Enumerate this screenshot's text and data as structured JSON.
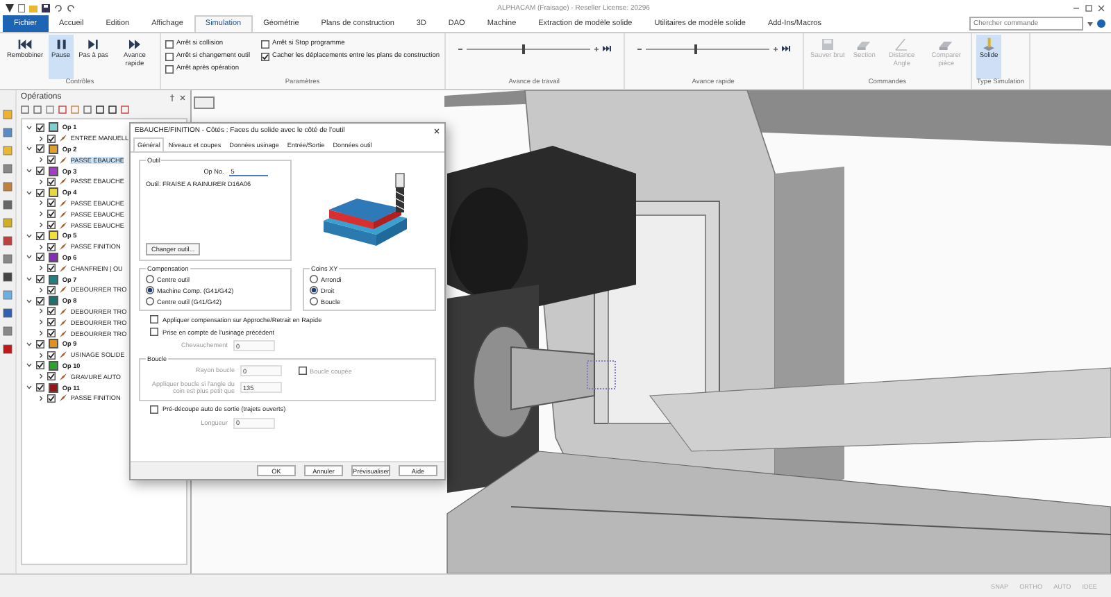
{
  "window": {
    "title": "ALPHACAM (Fraisage) - Reseller License: 20296"
  },
  "menu_tabs": [
    {
      "label": "Fichier",
      "kind": "file",
      "selected": false
    },
    {
      "label": "Accueil",
      "kind": "tab",
      "selected": false
    },
    {
      "label": "Edition",
      "kind": "tab",
      "selected": false
    },
    {
      "label": "Affichage",
      "kind": "tab",
      "selected": false
    },
    {
      "label": "Simulation",
      "kind": "tab",
      "selected": true
    },
    {
      "label": "Géométrie",
      "kind": "tab",
      "selected": false
    },
    {
      "label": "Plans de construction",
      "kind": "tab",
      "selected": false
    },
    {
      "label": "3D",
      "kind": "tab",
      "selected": false
    },
    {
      "label": "DAO",
      "kind": "tab",
      "selected": false
    },
    {
      "label": "Machine",
      "kind": "tab",
      "selected": false
    },
    {
      "label": "Extraction de modèle solide",
      "kind": "tab",
      "selected": false
    },
    {
      "label": "Utilitaires de modèle solide",
      "kind": "tab",
      "selected": false
    },
    {
      "label": "Add-Ins/Macros",
      "kind": "tab",
      "selected": false
    }
  ],
  "search": {
    "placeholder": "Chercher commande"
  },
  "ribbon": [
    {
      "title": "Contrôles",
      "kind": "buttons",
      "items": [
        {
          "label": "Rembobiner",
          "selected": false,
          "disabled": false
        },
        {
          "label": "Pause",
          "selected": true,
          "disabled": false
        },
        {
          "label": "Pas à pas",
          "selected": false,
          "disabled": false
        },
        {
          "label": "Avance rapide",
          "selected": false,
          "disabled": false
        }
      ]
    },
    {
      "title": "Paramètres",
      "kind": "checks",
      "items": [
        {
          "label": "Arrêt si collision",
          "checked": false
        },
        {
          "label": "Arrêt si changement outil",
          "checked": false
        },
        {
          "label": "Arrêt après opération",
          "checked": false
        },
        {
          "label": "Arrêt si Stop programme",
          "checked": false
        },
        {
          "label": "Cacher les déplacements entre les plans de construction",
          "checked": true
        }
      ]
    },
    {
      "title": "Avance de travail",
      "kind": "slider",
      "level": 0.45
    },
    {
      "title": "Avance rapide",
      "kind": "slider",
      "level": 0.4
    },
    {
      "title": "Commandes",
      "kind": "buttons",
      "items": [
        {
          "label": "Sauver brut",
          "selected": false,
          "disabled": true
        },
        {
          "label": "Section",
          "selected": false,
          "disabled": true
        },
        {
          "label": "Distance Angle",
          "selected": false,
          "disabled": true
        },
        {
          "label": "Comparer pièce",
          "selected": false,
          "disabled": true
        }
      ]
    },
    {
      "title": "Type Simulation",
      "kind": "buttons",
      "items": [
        {
          "label": "Solide",
          "selected": true,
          "disabled": false
        }
      ]
    }
  ],
  "operations": {
    "title": "Opérations",
    "items": [
      {
        "label": "Op 1",
        "color": "#7fcfcf",
        "checked": true,
        "expanded": true,
        "children": [
          {
            "label": "ENTREE MANUELL",
            "checked": true,
            "selected": false
          }
        ]
      },
      {
        "label": "Op 2",
        "color": "#e0a030",
        "checked": true,
        "expanded": true,
        "children": [
          {
            "label": "PASSE EBAUCHE",
            "checked": true,
            "selected": true
          }
        ]
      },
      {
        "label": "Op 3",
        "color": "#a040c0",
        "checked": true,
        "expanded": true,
        "children": [
          {
            "label": "PASSE EBAUCHE",
            "checked": true,
            "selected": false
          }
        ]
      },
      {
        "label": "Op 4",
        "color": "#e8d840",
        "checked": true,
        "expanded": true,
        "children": [
          {
            "label": "PASSE EBAUCHE",
            "checked": true,
            "selected": false
          },
          {
            "label": "PASSE EBAUCHE",
            "checked": true,
            "selected": false
          },
          {
            "label": "PASSE EBAUCHE",
            "checked": true,
            "selected": false
          }
        ]
      },
      {
        "label": "Op 5",
        "color": "#f0e040",
        "checked": true,
        "expanded": true,
        "children": [
          {
            "label": "PASSE FINITION",
            "checked": true,
            "selected": false
          }
        ]
      },
      {
        "label": "Op 6",
        "color": "#8030b0",
        "checked": true,
        "expanded": true,
        "children": [
          {
            "label": "CHANFREIN | OU",
            "checked": true,
            "selected": false
          }
        ]
      },
      {
        "label": "Op 7",
        "color": "#208080",
        "checked": true,
        "expanded": true,
        "children": [
          {
            "label": "DEBOURRER TRO",
            "checked": true,
            "selected": false
          }
        ]
      },
      {
        "label": "Op 8",
        "color": "#207070",
        "checked": true,
        "expanded": true,
        "children": [
          {
            "label": "DEBOURRER TRO",
            "checked": true,
            "selected": false
          },
          {
            "label": "DEBOURRER TRO",
            "checked": true,
            "selected": false
          },
          {
            "label": "DEBOURRER TRO",
            "checked": true,
            "selected": false
          }
        ]
      },
      {
        "label": "Op 9",
        "color": "#e09020",
        "checked": true,
        "expanded": true,
        "children": [
          {
            "label": "USINAGE SOLIDE",
            "checked": true,
            "selected": false
          }
        ]
      },
      {
        "label": "Op 10",
        "color": "#30a030",
        "checked": true,
        "expanded": true,
        "children": [
          {
            "label": "GRAVURE AUTO",
            "checked": true,
            "selected": false
          }
        ]
      },
      {
        "label": "Op 11",
        "color": "#901818",
        "checked": true,
        "expanded": true,
        "children": [
          {
            "label": "PASSE FINITION",
            "checked": true,
            "selected": false
          }
        ]
      }
    ]
  },
  "dialog": {
    "title": "EBAUCHE/FINITION - Côtés : Faces du solide avec le côté de l'outil",
    "tabs": [
      {
        "label": "Général",
        "selected": true
      },
      {
        "label": "Niveaux et coupes",
        "selected": false
      },
      {
        "label": "Données usinage",
        "selected": false
      },
      {
        "label": "Entrée/Sortie",
        "selected": false
      },
      {
        "label": "Données outil",
        "selected": false
      }
    ],
    "outil": {
      "title": "Outil",
      "op_no_label": "Op No.",
      "op_no_value": "5",
      "tool": "Outil: FRAISE A RAINURER D16A06",
      "change_button": "Changer outil..."
    },
    "compensation": {
      "title": "Compensation",
      "options": [
        {
          "label": "Centre outil",
          "selected": false
        },
        {
          "label": "Machine Comp. (G41/G42)",
          "selected": true
        },
        {
          "label": "Centre outil (G41/G42)",
          "selected": false
        }
      ]
    },
    "coins": {
      "title": "Coins XY",
      "options": [
        {
          "label": "Arrondi",
          "selected": false
        },
        {
          "label": "Droit",
          "selected": true
        },
        {
          "label": "Boucle",
          "selected": false
        }
      ]
    },
    "checks": [
      {
        "label": "Appliquer compensation sur Approche/Retrait en Rapide",
        "checked": false
      },
      {
        "label": "Prise en compte de l'usinage précédent",
        "checked": false
      }
    ],
    "chevauchement": {
      "label": "Chevauchement",
      "value": "0",
      "disabled": true
    },
    "boucle": {
      "title": "Boucle",
      "rayon": {
        "label": "Rayon boucle",
        "value": "0",
        "disabled": true
      },
      "coupee": {
        "label": "Boucle coupée",
        "checked": false,
        "disabled": true
      },
      "angle": {
        "label": "Appliquer boucle si l'angle du coin est plus petit que",
        "value": "135",
        "disabled": true
      }
    },
    "predecoupe": {
      "label": "Pré-découpe auto de sortie (trajets ouverts)",
      "checked": false
    },
    "longueur": {
      "label": "Longueur",
      "value": "0",
      "disabled": true
    },
    "buttons": [
      "OK",
      "Annuler",
      "Prévisualiser",
      "Aide"
    ]
  },
  "status_bar": [
    "SNAP",
    "ORTHO",
    "AUTO",
    "IDEE"
  ]
}
